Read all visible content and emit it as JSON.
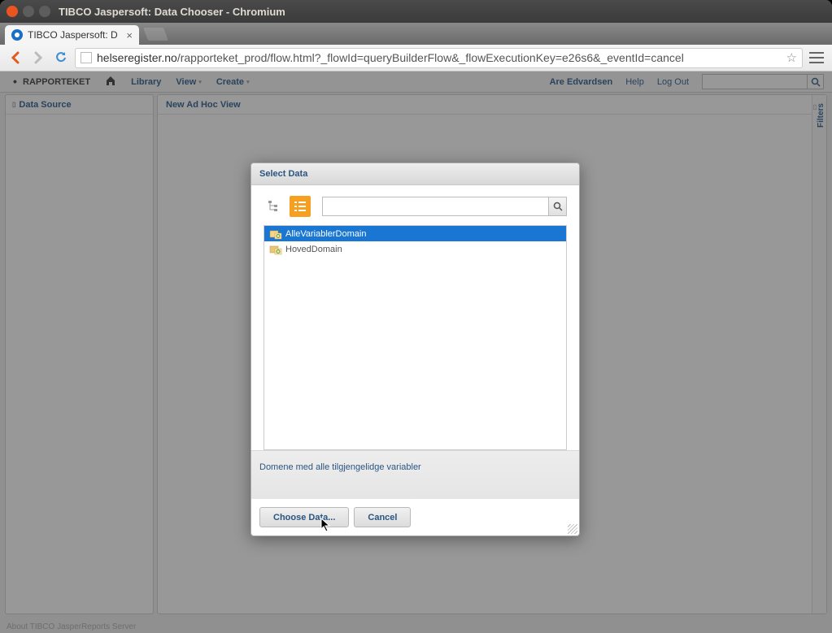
{
  "window": {
    "title": "TIBCO Jaspersoft: Data Chooser - Chromium"
  },
  "tab": {
    "title": "TIBCO Jaspersoft: D"
  },
  "address": {
    "host": "helseregister.no",
    "path": "/rapporteket_prod/flow.html?_flowId=queryBuilderFlow&_flowExecutionKey=e26s6&_eventId=cancel"
  },
  "app": {
    "brand": "RAPPORTEKET",
    "menu": {
      "library": "Library",
      "view": "View",
      "create": "Create"
    },
    "user": "Are Edvardsen",
    "help": "Help",
    "logout": "Log Out",
    "search_placeholder": ""
  },
  "panels": {
    "left_title": "Data Source",
    "main_title": "New Ad Hoc View",
    "filters": "Filters"
  },
  "dialog": {
    "title": "Select Data",
    "search_placeholder": "",
    "items": [
      {
        "label": "AlleVariablerDomain",
        "selected": true
      },
      {
        "label": "HovedDomain",
        "selected": false
      }
    ],
    "description": "Domene med alle tilgjengelidge variabler",
    "choose": "Choose Data...",
    "cancel": "Cancel"
  },
  "footer": "About TIBCO JasperReports Server"
}
